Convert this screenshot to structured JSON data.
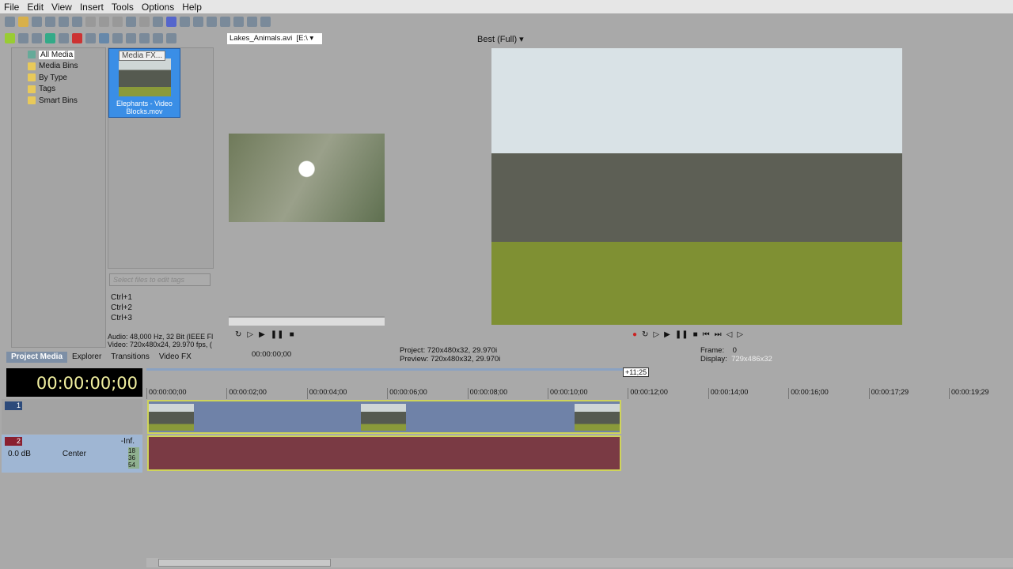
{
  "menu": [
    "File",
    "Edit",
    "View",
    "Insert",
    "Tools",
    "Options",
    "Help"
  ],
  "tree": [
    "All Media",
    "Media Bins",
    "By Type",
    "Tags",
    "Smart Bins"
  ],
  "media_clip": "Elephants - Video Blocks.mov",
  "tooltip": "Media FX...",
  "tags_placeholder": "Select files to edit tags",
  "shortcuts": [
    "Ctrl+1",
    "Ctrl+2",
    "Ctrl+3"
  ],
  "media_info": [
    "Audio: 48,000 Hz, 32 Bit (IEEE Fl",
    "Video: 720x480x24, 29.970 fps, ("
  ],
  "tabs": [
    "Project Media",
    "Explorer",
    "Transitions",
    "Video FX"
  ],
  "trimmer": {
    "file": "Lakes_Animals.avi",
    "path": "[E:\\",
    "time": "00:00:00;00"
  },
  "preview": {
    "quality": "Best (Full)",
    "project": "Project:  720x480x32, 29.970i",
    "preview": "Preview:  720x480x32, 29.970i",
    "frame_label": "Frame:",
    "frame": "0",
    "display_label": "Display:",
    "display": "729x486x32"
  },
  "timeline": {
    "timecode": "00:00:00;00",
    "loop_length": "+11;25",
    "ruler": [
      "00:00:00;00",
      "00:00:02;00",
      "00:00:04;00",
      "00:00:06;00",
      "00:00:08;00",
      "00:00:10;00",
      "00:00:12;00",
      "00:00:14;00",
      "00:00:16;00",
      "00:00:17;29",
      "00:00:19;29"
    ]
  },
  "tracks": {
    "video_num": "1",
    "audio_num": "2",
    "volume": "0.0 dB",
    "pan": "Center",
    "meter": "-Inf.",
    "meter_ticks": [
      "18",
      "36",
      "54"
    ]
  }
}
